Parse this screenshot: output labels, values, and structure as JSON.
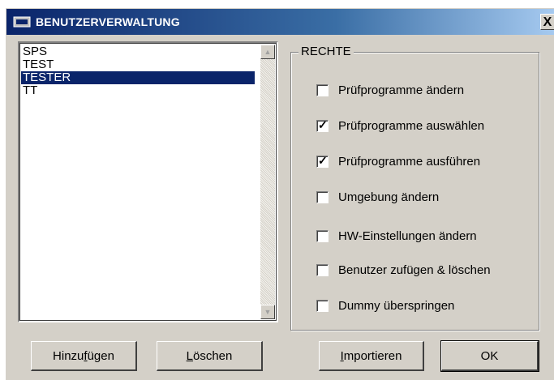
{
  "window": {
    "title": "BENUTZERVERWALTUNG",
    "close_label": "X"
  },
  "users": [
    {
      "name": "SPS",
      "selected": false
    },
    {
      "name": "TEST",
      "selected": false
    },
    {
      "name": "TESTER",
      "selected": true
    },
    {
      "name": "TT",
      "selected": false
    }
  ],
  "rights": {
    "title": "RECHTE",
    "items": [
      {
        "label": "Prüfprogramme ändern",
        "checked": false
      },
      {
        "label": "Prüfprogramme auswählen",
        "checked": true
      },
      {
        "label": "Prüfprogramme ausführen",
        "checked": true
      },
      {
        "label": "Umgebung ändern",
        "checked": false
      },
      {
        "label": "HW-Einstellungen ändern",
        "checked": false
      },
      {
        "label": "Benutzer zufügen & löschen",
        "checked": false
      },
      {
        "label": "Dummy überspringen",
        "checked": false
      }
    ]
  },
  "buttons": {
    "add": {
      "pre": "Hinzu",
      "accel": "f",
      "post": "ügen"
    },
    "delete": {
      "pre": "",
      "accel": "L",
      "post": "öschen"
    },
    "import": {
      "pre": "",
      "accel": "I",
      "post": "mportieren"
    },
    "ok": {
      "pre": "OK",
      "accel": "",
      "post": ""
    }
  },
  "colors": {
    "selection": "#0a246a",
    "dialog_bg": "#d4d0c8",
    "titlebar": "#0a246a"
  }
}
